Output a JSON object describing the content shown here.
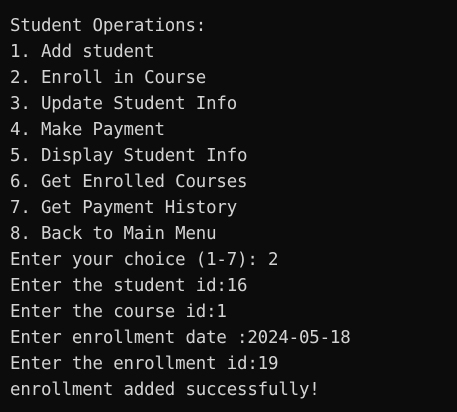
{
  "terminal": {
    "lines": [
      "Student Operations:",
      "1. Add student",
      "2. Enroll in Course",
      "3. Update Student Info",
      "4. Make Payment",
      "5. Display Student Info",
      "6. Get Enrolled Courses",
      "7. Get Payment History",
      "8. Back to Main Menu",
      "Enter your choice (1-7): 2",
      "Enter the student id:16",
      "Enter the course id:1",
      "Enter enrollment date :2024-05-18",
      "Enter the enrollment id:19",
      "enrollment added successfully!"
    ]
  },
  "colors": {
    "background": "#0c0c0c",
    "text": "#d4d4d4"
  }
}
